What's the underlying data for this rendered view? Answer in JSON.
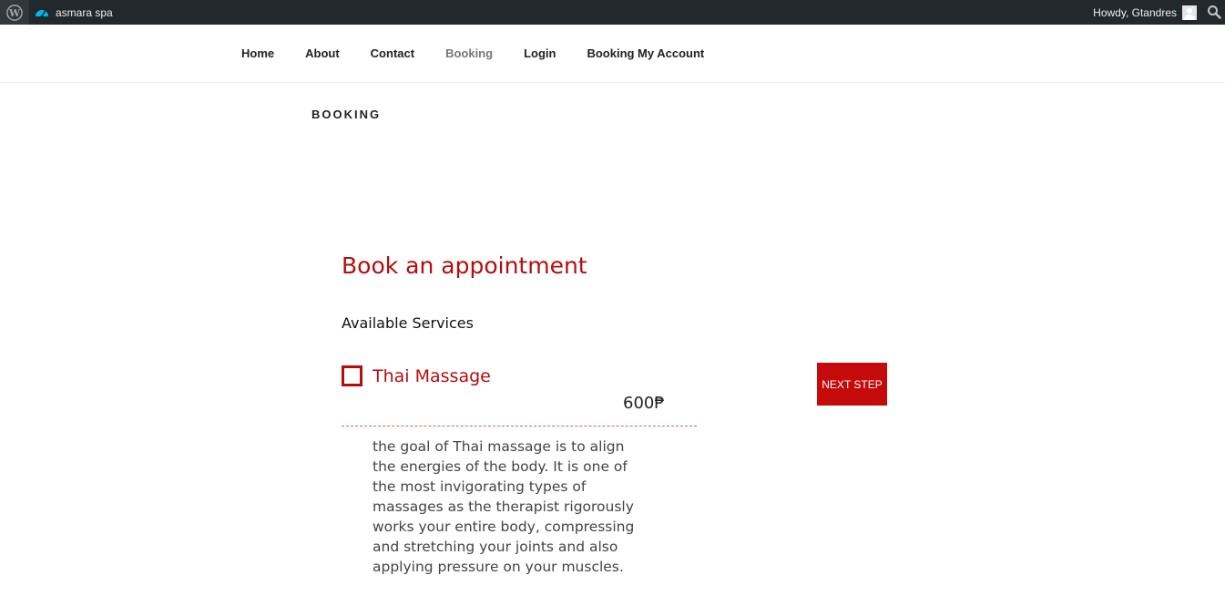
{
  "adminbar": {
    "site_name": "asmara spa",
    "howdy": "Howdy, Gtandres",
    "icons": {
      "wordpress": "wordpress-logo-icon",
      "site": "dashboard-gauge-icon",
      "avatar": "user-avatar-icon",
      "search": "search-icon"
    }
  },
  "nav": {
    "items": [
      {
        "label": "Home"
      },
      {
        "label": "About"
      },
      {
        "label": "Contact"
      },
      {
        "label": "Booking",
        "current": true
      },
      {
        "label": "Login"
      },
      {
        "label": "Booking My Account"
      }
    ]
  },
  "page": {
    "title": "BOOKING"
  },
  "booking": {
    "heading": "Book an appointment",
    "services_label": "Available Services",
    "services": [
      {
        "name": "Thai Massage",
        "price": "600₱",
        "checked": false,
        "description": "the goal of Thai massage is to align the energies of the body. It is one of the most invigorating types of massages as the therapist rigorously works your entire body, compressing and stretching your joints and also applying pressure on your muscles."
      }
    ],
    "next_step_label": "NEXT STEP"
  },
  "colors": {
    "accent": "#b70c0c",
    "button": "#c40a0a",
    "adminbar": "#23282d"
  }
}
